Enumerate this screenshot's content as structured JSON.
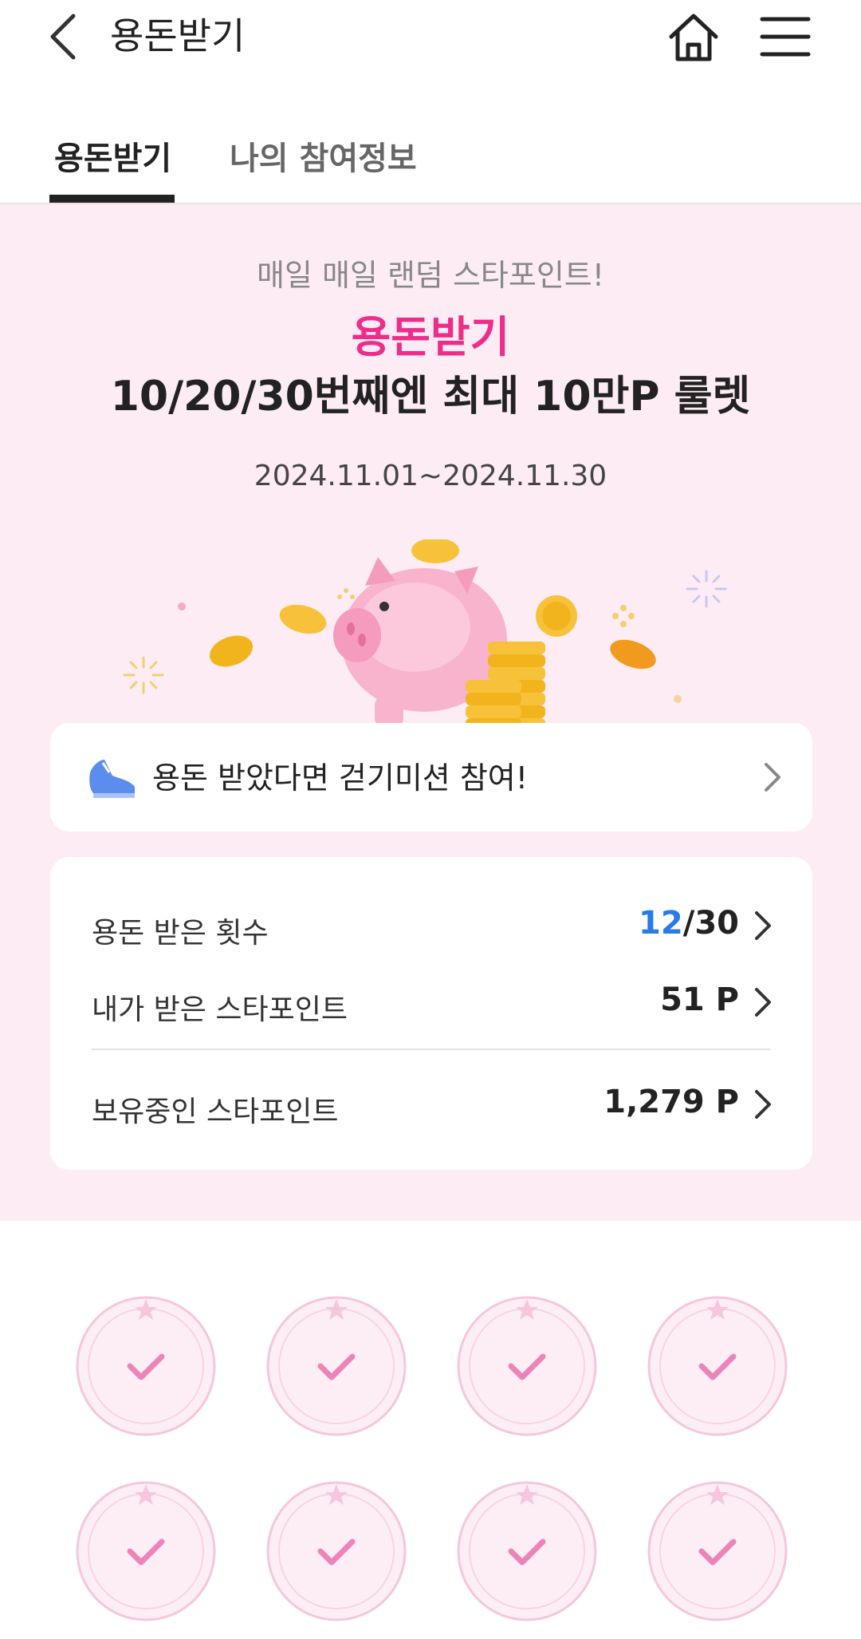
{
  "header": {
    "title": "용돈받기"
  },
  "tabs": [
    {
      "label": "용돈받기",
      "active": true
    },
    {
      "label": "나의 참여정보",
      "active": false
    }
  ],
  "event": {
    "subtitle": "매일 매일 랜덤 스타포인트!",
    "title_pink": "용돈받기",
    "title_main": "10/20/30번째엔 최대 10만P 룰렛",
    "period": "2024.11.01~2024.11.30"
  },
  "walk_banner": {
    "label": "용돈 받았다면 걷기미션 참여!"
  },
  "stats": {
    "count_label": "용돈 받은 횟수",
    "count_current": "12",
    "count_total": "/30",
    "received_label": "내가 받은 스타포인트",
    "received_value": "51 P",
    "holding_label": "보유중인 스타포인트",
    "holding_value": "1,279 P"
  },
  "stamps": {
    "visible_count": 8,
    "state": "checked"
  },
  "colors": {
    "accent_pink": "#ee2d8a",
    "section_bg": "#fdecf4",
    "highlight_blue": "#2a7ae8"
  }
}
